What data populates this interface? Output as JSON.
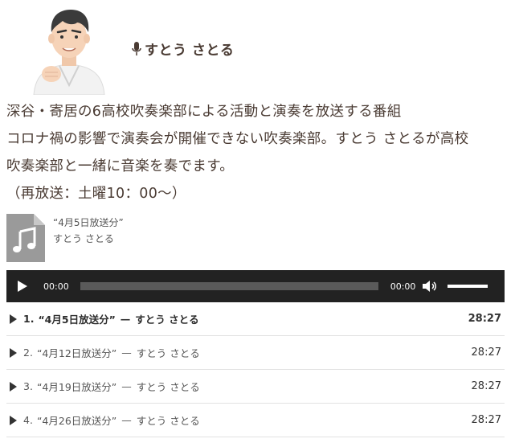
{
  "host": {
    "name": "すとう さとる",
    "icon": "microphone-icon"
  },
  "description": [
    "深谷・寄居の6高校吹奏楽部による活動と演奏を放送する番組",
    "コロナ禍の影響で演奏会が開催できない吹奏楽部。すとう さとるが高校",
    "吹奏楽部と一緒に音楽を奏でます。",
    "（再放送：土曜10：00～）"
  ],
  "current_track": {
    "title": "“4月5日放送分”",
    "artist": "すとう さとる"
  },
  "player": {
    "current_time": "00:00",
    "duration": "00:00",
    "progress": 0,
    "volume": 1.0
  },
  "playlist": [
    {
      "num": "1.",
      "title": "“4月5日放送分”",
      "sep": "—",
      "artist": "すとう さとる",
      "length": "28:27",
      "active": true
    },
    {
      "num": "2.",
      "title": "“4月12日放送分”",
      "sep": "—",
      "artist": "すとう さとる",
      "length": "28:27",
      "active": false
    },
    {
      "num": "3.",
      "title": "“4月19日放送分”",
      "sep": "—",
      "artist": "すとう さとる",
      "length": "28:27",
      "active": false
    },
    {
      "num": "4.",
      "title": "“4月26日放送分”",
      "sep": "—",
      "artist": "すとう さとる",
      "length": "28:27",
      "active": false
    }
  ],
  "colors": {
    "text": "#4a3b33",
    "player_bg": "#222222",
    "rail": "#5a5a5a"
  }
}
